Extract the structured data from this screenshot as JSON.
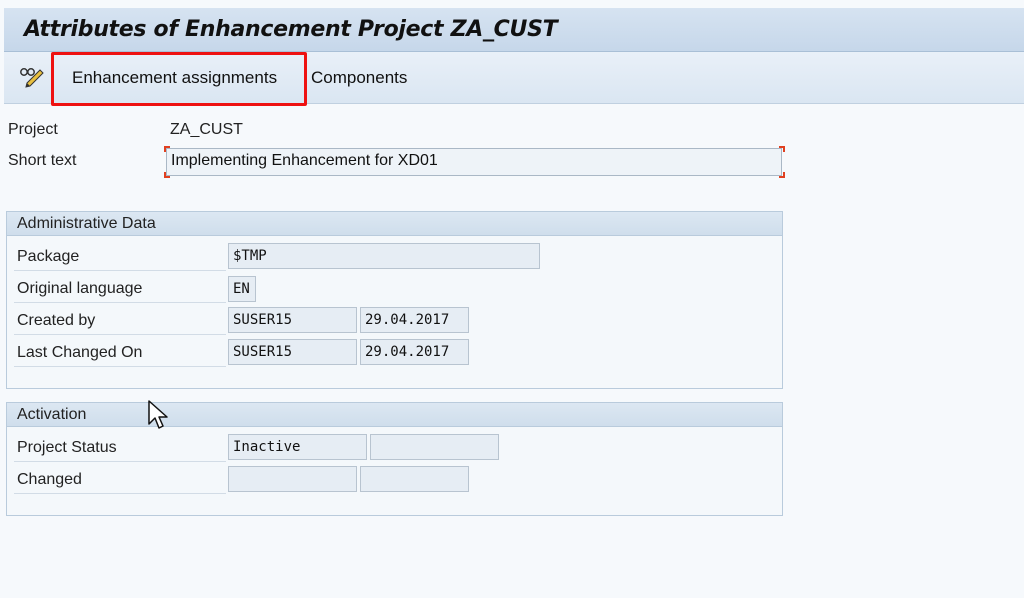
{
  "window": {
    "title": "Attributes of Enhancement Project ZA_CUST"
  },
  "toolbar": {
    "edit_icon": "pencil-glasses-icon",
    "enhancement_assignments": "Enhancement assignments",
    "components": "Components",
    "highlight_color": "#ee1111"
  },
  "header_fields": {
    "project_label": "Project",
    "project_value": "ZA_CUST",
    "short_text_label": "Short text",
    "short_text_value": "Implementing Enhancement for XD01"
  },
  "admin": {
    "title": "Administrative Data",
    "package_label": "Package",
    "package_value": "$TMP",
    "orig_lang_label": "Original language",
    "orig_lang_value": "EN",
    "created_by_label": "Created by",
    "created_by_user": "SUSER15",
    "created_by_date": "29.04.2017",
    "last_changed_label": "Last Changed On",
    "last_changed_user": "SUSER15",
    "last_changed_date": "29.04.2017"
  },
  "activation": {
    "title": "Activation",
    "status_label": "Project Status",
    "status_value": "Inactive",
    "status_extra": "",
    "changed_label": "Changed",
    "changed_user": "",
    "changed_date": ""
  }
}
